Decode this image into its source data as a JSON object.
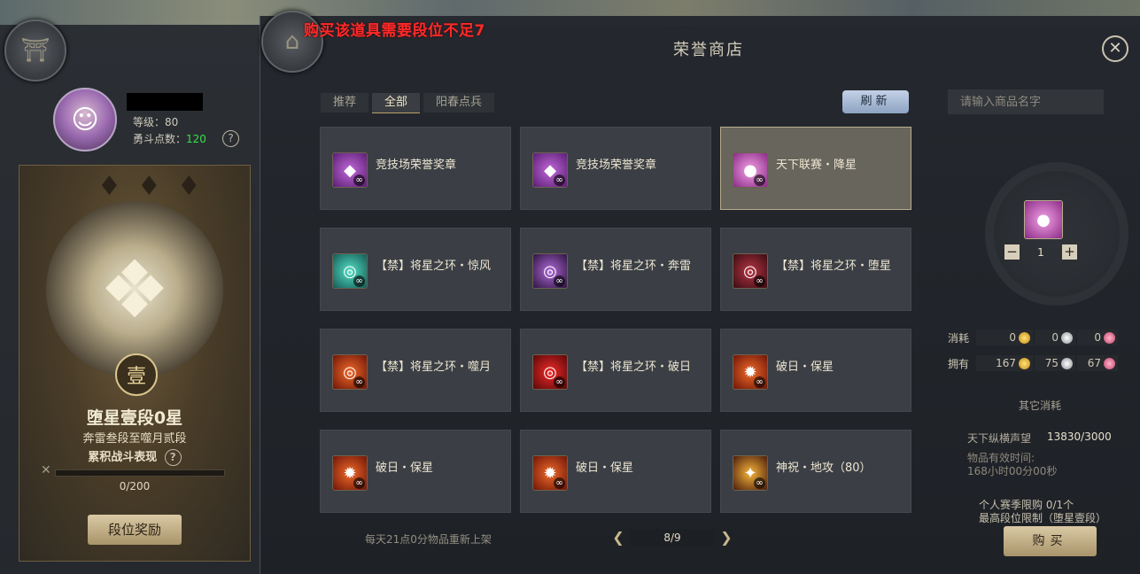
{
  "warning": "购买该道具需要段位不足7",
  "shop_title": "荣誉商店",
  "close_label": "✕",
  "player": {
    "level_text": "等级：80",
    "points_label": "勇斗点数：",
    "points_value": "120"
  },
  "rank": {
    "seal": "壹",
    "name": "堕星壹段0星",
    "sub": "奔雷叁段至噬月贰段",
    "sub2": "累积战斗表现",
    "progress_text": "0/200",
    "progress_fraction": 0,
    "reward_button": "段位奖励"
  },
  "tabs": [
    {
      "label": "推荐"
    },
    {
      "label": "全部"
    },
    {
      "label": "阳春点兵"
    }
  ],
  "refresh_label": "刷新",
  "items": [
    {
      "label": "竞技场荣誉奖章",
      "icon": "medal-icon",
      "color": "purple"
    },
    {
      "label": "竞技场荣誉奖章",
      "icon": "medal-icon",
      "color": "purple"
    },
    {
      "label": "天下联赛・降星",
      "icon": "potion-icon",
      "color": "pink"
    },
    {
      "label": "【禁】将星之环・惊风",
      "icon": "ring-icon",
      "color": "teal"
    },
    {
      "label": "【禁】将星之环・奔雷",
      "icon": "ring-icon",
      "color": "violet"
    },
    {
      "label": "【禁】将星之环・堕星",
      "icon": "ring-icon",
      "color": "wine"
    },
    {
      "label": "【禁】将星之环・噬月",
      "icon": "ring-icon",
      "color": "orange"
    },
    {
      "label": "【禁】将星之环・破日",
      "icon": "ring-icon",
      "color": "red"
    },
    {
      "label": "破日・保星",
      "icon": "flame-icon",
      "color": "orange"
    },
    {
      "label": "破日・保星",
      "icon": "flame-icon",
      "color": "orange"
    },
    {
      "label": "破日・保星",
      "icon": "flame-icon",
      "color": "orange"
    },
    {
      "label": "神祝・地攻（80）",
      "icon": "wing-icon",
      "color": "gold"
    }
  ],
  "infinity_mark": "∞",
  "footer_note": "每天21点0分物品重新上架",
  "pager": {
    "text": "8/9",
    "prev": "❮",
    "next": "❯"
  },
  "search": {
    "placeholder": "请输入商品名字"
  },
  "quantity": {
    "value": "1",
    "minus": "−",
    "plus": "+"
  },
  "cost": {
    "consume_label": "消耗",
    "own_label": "拥有",
    "consume": [
      "0",
      "0",
      "0"
    ],
    "own": [
      "167",
      "75",
      "67"
    ]
  },
  "other_title": "其它消耗",
  "reputation_label": "天下纵横声望",
  "reputation_value": "13830/3000",
  "validity_label": "物品有效时间:",
  "validity_value": "168小时00分00秒",
  "season_limit": "个人赛季限购 0/1个",
  "rank_limit": "最高段位限制（堕星壹段）",
  "buy_label": "购买"
}
